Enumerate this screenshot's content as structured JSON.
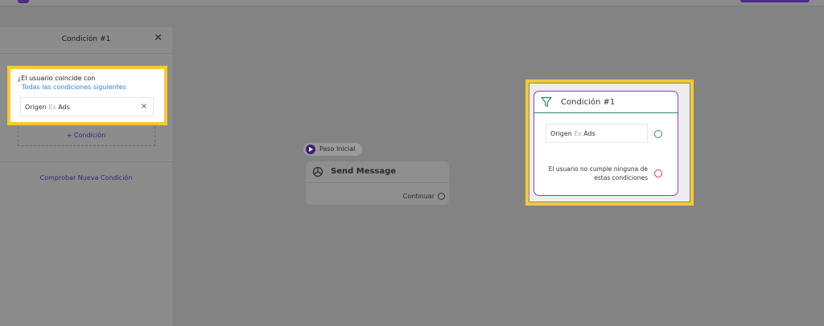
{
  "panel": {
    "title": "Condición #1",
    "match_question": "¿El usuario coincide con",
    "match_mode": "Todas las condiciones siguientes",
    "condition": {
      "field": "Origen",
      "operator": "Es",
      "value": "Ads"
    },
    "add_condition_label": "+ Condición",
    "check_new_label": "Comprobar Nueva Condición"
  },
  "canvas": {
    "start_label": "Paso Inicial",
    "node": {
      "title": "Send Message",
      "continue_label": "Continuar"
    },
    "condition_card": {
      "title": "Condición #1",
      "condition": {
        "field": "Origen",
        "operator": "Es",
        "value": "Ads"
      },
      "else_label": "El usuario no cumple ninguna de estas condiciones"
    }
  },
  "colors": {
    "highlight": "#f4c934",
    "brand": "#4a2a8c",
    "link": "#2a82d8",
    "match_port": "#2e9e4e",
    "else_port": "#d8343a"
  }
}
